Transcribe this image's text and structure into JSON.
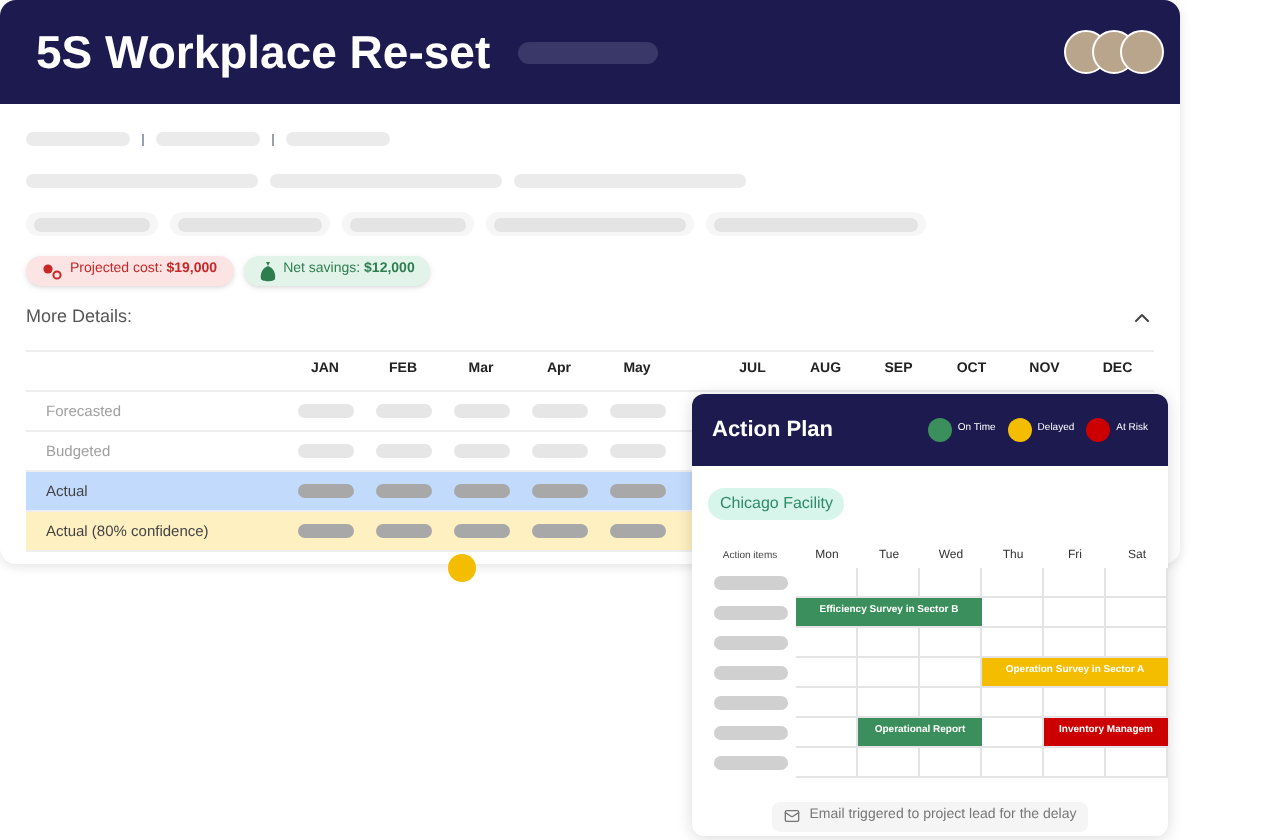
{
  "header": {
    "title": "5S Workplace Re-set"
  },
  "badges": [
    {
      "kind": "cost",
      "text": "Projected cost: **$19,000**"
    },
    {
      "kind": "savings",
      "text": "Net savings: **$12,000**"
    }
  ],
  "details": {
    "title": "More Details:",
    "expanded": true
  },
  "table": {
    "months_before_gap": [
      "JAN",
      "FEB",
      "Mar",
      "Apr",
      "May"
    ],
    "months_after_gap": [
      "JUL",
      "AUG",
      "SEP",
      "OCT",
      "NOV",
      "DEC"
    ],
    "rows": [
      {
        "label": "Forecasted",
        "kind": "plan"
      },
      {
        "label": "Budgeted",
        "kind": "plan"
      },
      {
        "label": "Actual",
        "kind": "actual"
      },
      {
        "label": "Actual (80% confidence)",
        "kind": "confidence"
      }
    ]
  },
  "action_plan": {
    "title": "Action Plan",
    "legend": [
      {
        "label": "On Time",
        "color": "#3a8f5c"
      },
      {
        "label": "Delayed",
        "color": "#f5bd00"
      },
      {
        "label": "At Risk",
        "color": "#cc0000"
      }
    ],
    "facility": "Chicago Facility",
    "items_heading": "Action items",
    "days": [
      "Mon",
      "Tue",
      "Wed",
      "Thu",
      "Fri",
      "Sat"
    ],
    "schedule": [
      {
        "cells": [
          {
            "kind": "empty"
          },
          {
            "kind": "empty"
          },
          {
            "kind": "empty"
          },
          {
            "kind": "empty"
          },
          {
            "kind": "empty"
          },
          {
            "kind": "empty"
          }
        ]
      },
      {
        "cells": [
          {
            "kind": "task",
            "label": "Efficiency Survey in Sector B",
            "color": "#3a8f5c"
          },
          {
            "kind": "continued"
          },
          {
            "kind": "continued"
          },
          {
            "kind": "empty"
          },
          {
            "kind": "empty"
          },
          {
            "kind": "empty"
          }
        ]
      },
      {
        "cells": [
          {
            "kind": "empty"
          },
          {
            "kind": "empty"
          },
          {
            "kind": "empty"
          },
          {
            "kind": "empty"
          },
          {
            "kind": "empty"
          },
          {
            "kind": "empty"
          }
        ]
      },
      {
        "cells": [
          {
            "kind": "empty"
          },
          {
            "kind": "empty"
          },
          {
            "kind": "empty"
          },
          {
            "kind": "task",
            "label": "Operation Survey in Sector A",
            "color": "#f5bd00"
          },
          {
            "kind": "continued"
          },
          {
            "kind": "continued"
          }
        ]
      },
      {
        "cells": [
          {
            "kind": "empty"
          },
          {
            "kind": "empty"
          },
          {
            "kind": "empty"
          },
          {
            "kind": "empty"
          },
          {
            "kind": "empty"
          },
          {
            "kind": "empty"
          }
        ]
      },
      {
        "cells": [
          {
            "kind": "empty"
          },
          {
            "kind": "task",
            "label": "Operational Report",
            "color": "#3a8f5c"
          },
          {
            "kind": "continued"
          },
          {
            "kind": "empty"
          },
          {
            "kind": "task",
            "label": "Inventory Managem",
            "color": "#cc0000"
          },
          {
            "kind": "continued"
          }
        ]
      },
      {
        "cells": [
          {
            "kind": "empty"
          },
          {
            "kind": "empty"
          },
          {
            "kind": "empty"
          },
          {
            "kind": "empty"
          },
          {
            "kind": "empty"
          },
          {
            "kind": "empty"
          }
        ]
      }
    ],
    "footer": "Email triggered to project lead for the delay"
  }
}
